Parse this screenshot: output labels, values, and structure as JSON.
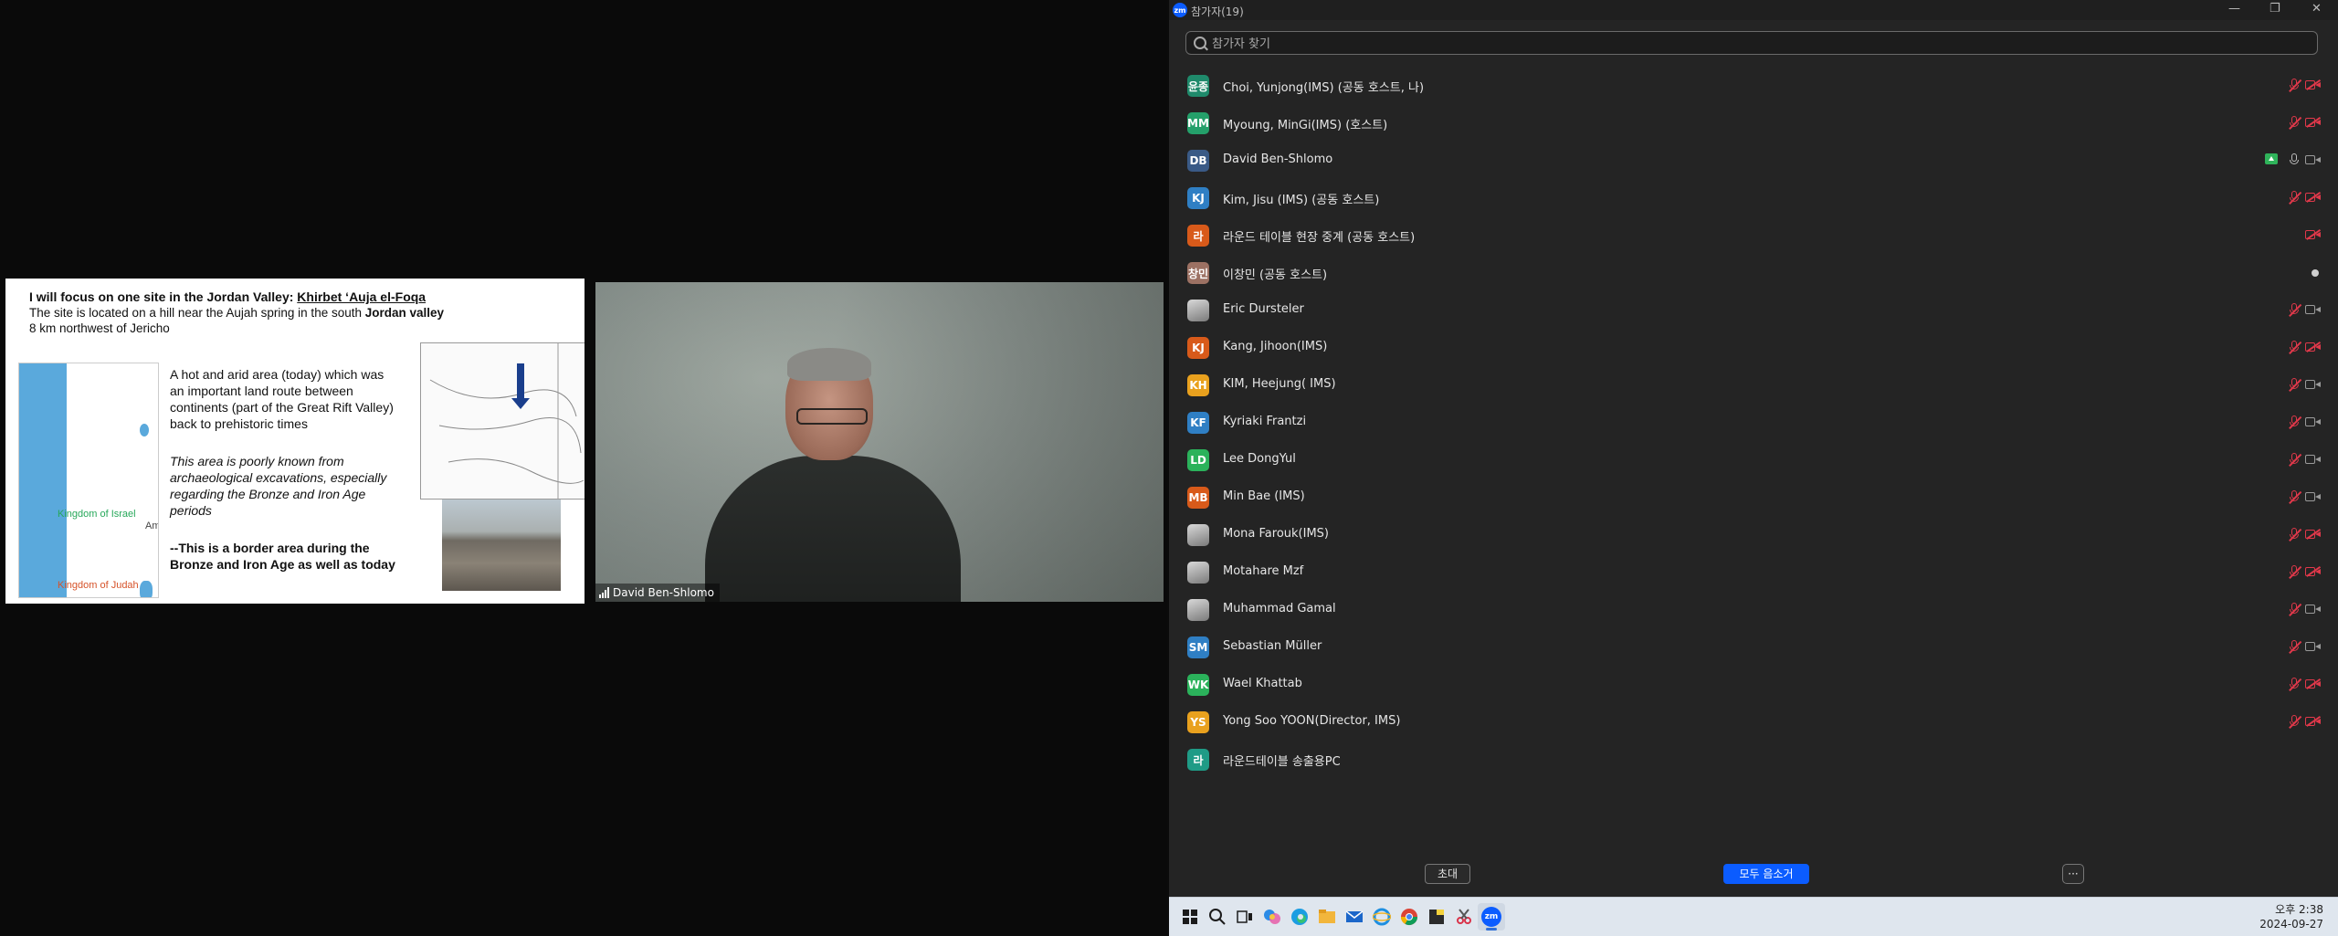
{
  "slide": {
    "title_prefix": "I will focus on one site in the Jordan Valley: ",
    "title_site": "Khirbet ‘Auja el-Foqa",
    "line2_a": "The site is located on a hill near the Aujah spring in the south ",
    "line2_b": "Jordan valley",
    "line3": "8 km northwest of Jericho",
    "para1": "A hot and arid area (today) which was an important land route between continents (part of the Great Rift Valley) back to prehistoric times",
    "para2": "This area is poorly known from archaeological excavations, especially regarding the Bronze and Iron Age periods",
    "para3": "--This is a border area during the Bronze and Iron Age as well as today",
    "map": {
      "kingdom_israel": "Kingdom of Israel",
      "kingdom_judah": "Kingdom of Judah",
      "ammon": "Ammon"
    }
  },
  "video": {
    "speaker_name": "David Ben-Shlomo"
  },
  "panel": {
    "title": "참가자(19)",
    "search_placeholder": "참가자 찾기",
    "participants": [
      {
        "initials": "윤종",
        "color": "#1f8a6b",
        "name": "Choi, Yunjong(IMS) (공동 호스트, 나)",
        "mic": "muted",
        "video": "off"
      },
      {
        "initials": "MM",
        "color": "#24a06a",
        "name": "Myoung, MinGi(IMS) (호스트)",
        "mic": "muted",
        "video": "off"
      },
      {
        "initials": "DB",
        "color": "#3a5a86",
        "name": "David Ben-Shlomo",
        "mic": "on",
        "video": "on",
        "sharing": true
      },
      {
        "initials": "KJ",
        "color": "#2f7fc4",
        "name": "Kim, Jisu (IMS) (공동 호스트)",
        "mic": "muted",
        "video": "off"
      },
      {
        "initials": "라",
        "color": "#d85a1a",
        "name": "라운드 테이블 현장 중계 (공동 호스트)",
        "mic": "none",
        "video": "off"
      },
      {
        "initials": "창민",
        "color": "#9c7163",
        "name": "이창민 (공동 호스트)",
        "mic": "none",
        "video": "dot"
      },
      {
        "initials": "",
        "color": "#8a8a8a",
        "photo": true,
        "name": "Eric Dursteler",
        "mic": "muted",
        "video": "on"
      },
      {
        "initials": "KJ",
        "color": "#d85a1a",
        "name": "Kang, Jihoon(IMS)",
        "mic": "muted",
        "video": "off"
      },
      {
        "initials": "KH",
        "color": "#e9a11e",
        "name": "KIM, Heejung( IMS)",
        "mic": "muted",
        "video": "on"
      },
      {
        "initials": "KF",
        "color": "#2f7fc4",
        "name": "Kyriaki Frantzi",
        "mic": "muted",
        "video": "on"
      },
      {
        "initials": "LD",
        "color": "#2bb25b",
        "name": "Lee DongYul",
        "mic": "muted",
        "video": "on"
      },
      {
        "initials": "MB",
        "color": "#d85a1a",
        "name": "Min Bae (IMS)",
        "mic": "muted",
        "video": "on"
      },
      {
        "initials": "",
        "color": "#8a8a8a",
        "photo": true,
        "name": "Mona Farouk(IMS)",
        "mic": "muted",
        "video": "off"
      },
      {
        "initials": "",
        "color": "#8a8a8a",
        "photo": true,
        "name": "Motahare Mzf",
        "mic": "muted",
        "video": "off"
      },
      {
        "initials": "",
        "color": "#8a8a8a",
        "photo": true,
        "name": "Muhammad Gamal",
        "mic": "muted",
        "video": "on"
      },
      {
        "initials": "SM",
        "color": "#2f7fc4",
        "name": "Sebastian Müller",
        "mic": "muted",
        "video": "on"
      },
      {
        "initials": "WK",
        "color": "#2bb25b",
        "name": "Wael Khattab",
        "mic": "muted",
        "video": "off"
      },
      {
        "initials": "YS",
        "color": "#e9a11e",
        "name": "Yong Soo YOON(Director, IMS)",
        "mic": "muted",
        "video": "off"
      },
      {
        "initials": "라",
        "color": "#1f9b86",
        "name": "라운드테이블 송출용PC",
        "mic": "none",
        "video": "none"
      }
    ],
    "buttons": {
      "invite": "초대",
      "mute_all": "모두 음소거",
      "more": "···"
    }
  },
  "taskbar": {
    "time": "오후 2:38",
    "date": "2024-09-27",
    "zoom_label": "zm"
  },
  "colors": {
    "accent": "#0b5cff",
    "mute_red": "#e0384a",
    "panel_bg": "#242424"
  }
}
